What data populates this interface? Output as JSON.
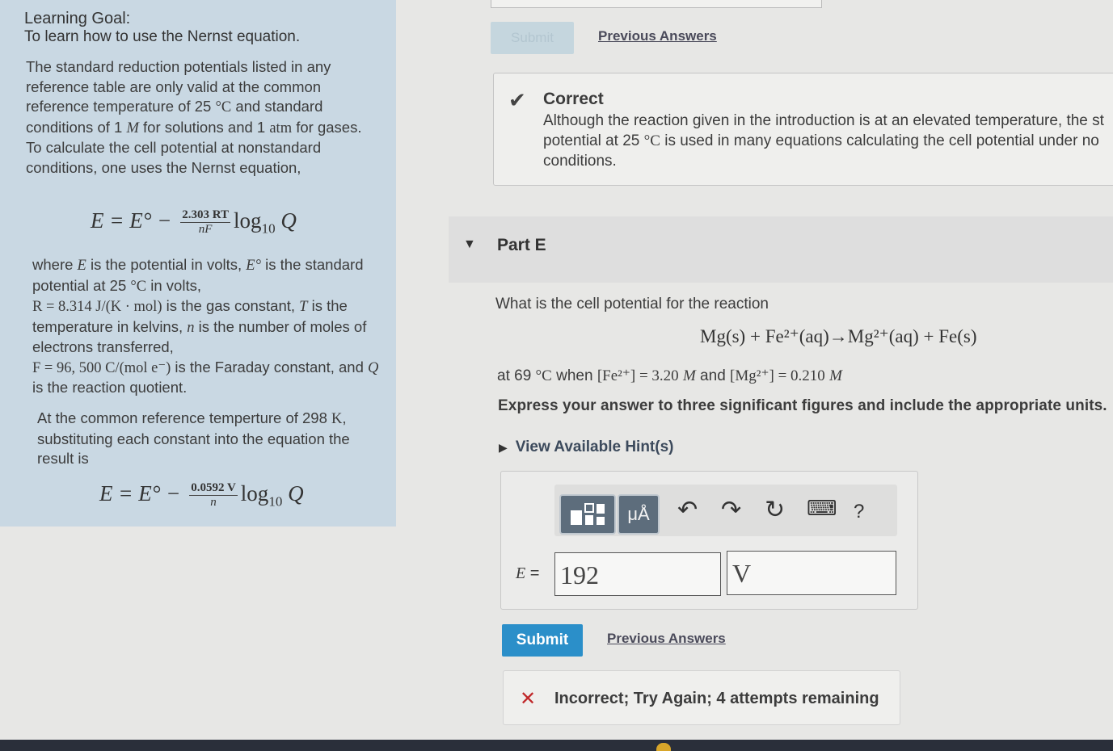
{
  "left_panel": {
    "goal_heading": "Learning Goal:",
    "goal_text": "To learn how to use the Nernst equation.",
    "intro": {
      "t1": "The standard reduction potentials listed in any reference table are only valid at the common reference temperature of 25 ",
      "unit_c": "°C",
      "t2": " and standard conditions of 1 ",
      "m": "M",
      "t3": " for solutions and 1 ",
      "atm": "atm",
      "t4": " for gases. To calculate the cell potential at nonstandard conditions, one uses the Nernst equation,"
    },
    "equation1": {
      "lhs": "E = E°  −",
      "numerator": "2.303 RT",
      "denominator": "nF",
      "log": "log",
      "log_sub": "10",
      "q": "Q"
    },
    "where": {
      "t1": "where ",
      "e": "E",
      "t2": " is the potential in volts, ",
      "e0": "E°",
      "t3": " is the standard potential at 25 ",
      "unit_c": "°C",
      "t4": " in volts,",
      "r_expr": "R = 8.314 J/(K · mol)",
      "t5": " is the gas constant, ",
      "t": "T",
      "t6": " is the temperature in kelvins, ",
      "n": "n",
      "t7": " is the number of moles of electrons transferred,",
      "f_expr": "F = 96, 500 C/(mol e⁻)",
      "t8": " is the Faraday constant, and ",
      "q": "Q",
      "t9": " is the reaction quotient."
    },
    "reference": {
      "t1": "At the common reference temperture of 298 ",
      "k": "K",
      "t2": ", substituting each constant into the equation the result is"
    },
    "equation2": {
      "lhs": "E = E°  −",
      "numerator": "0.0592 V",
      "denominator": "n",
      "log": "log",
      "log_sub": "10",
      "q": "Q"
    }
  },
  "top_submit_label": "Submit",
  "top_prev_answers": "Previous Answers",
  "correct": {
    "title": "Correct",
    "message_1": "Although the reaction given in the introduction is at an elevated temperature, the st",
    "message_2a": "potential at 25 ",
    "message_2b": "°C",
    "message_2c": " is used in many equations calculating the cell potential under no",
    "message_3": "conditions."
  },
  "part": {
    "label": "Part E"
  },
  "question": {
    "prompt": "What is the cell potential for the reaction",
    "reaction": "Mg(s) + Fe²⁺(aq)→Mg²⁺(aq) + Fe(s)",
    "cond_1": "at 69 ",
    "cond_unit": "°C",
    "cond_2": " when ",
    "fe_conc": "[Fe²⁺] = 3.20",
    "m1": "M",
    "cond_3": " and ",
    "mg_conc": "[Mg²⁺] = 0.210",
    "m2": "M",
    "instructions": "Express your answer to three significant figures and include the appropriate units.",
    "hints": "View Available Hint(s)"
  },
  "toolbar": {
    "units_tile": "μÅ",
    "undo": "↶",
    "redo": "↷",
    "reset": "↻",
    "keyboard": "⌨",
    "help": "?"
  },
  "answer": {
    "label": "E =",
    "value": "192",
    "units": "V"
  },
  "submit_label": "Submit",
  "prev_answers": "Previous Answers",
  "feedback": {
    "icon": "✕",
    "message": "Incorrect; Try Again; 4 attempts remaining"
  },
  "colors": {
    "submit": "#2b8fc9",
    "panel": "#c9d8e3",
    "error": "#c0282a"
  }
}
